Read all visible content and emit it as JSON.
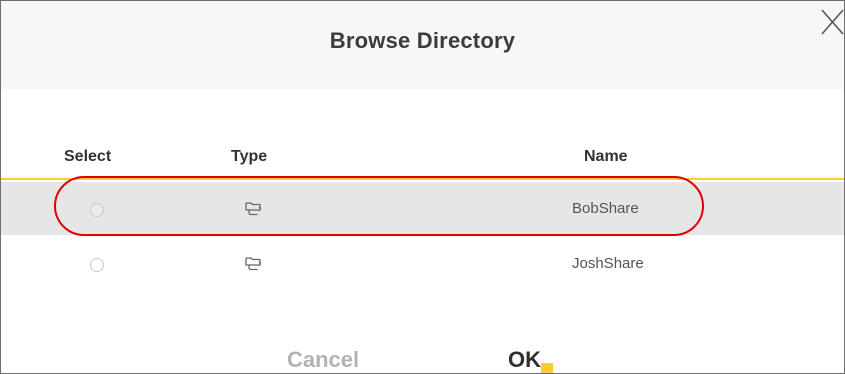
{
  "dialog": {
    "title": "Browse Directory",
    "close_icon": "close-icon",
    "accent_color": "#ffcc33",
    "highlight_color": "#e00000"
  },
  "table": {
    "columns": [
      "Select",
      "Type",
      "Name"
    ],
    "rows": [
      {
        "selected": false,
        "type_icon": "folder-share-icon",
        "name": "BobShare"
      },
      {
        "selected": false,
        "type_icon": "folder-share-icon",
        "name": "JoshShare"
      }
    ]
  },
  "actions": {
    "cancel_label": "Cancel",
    "ok_label": "OK"
  }
}
